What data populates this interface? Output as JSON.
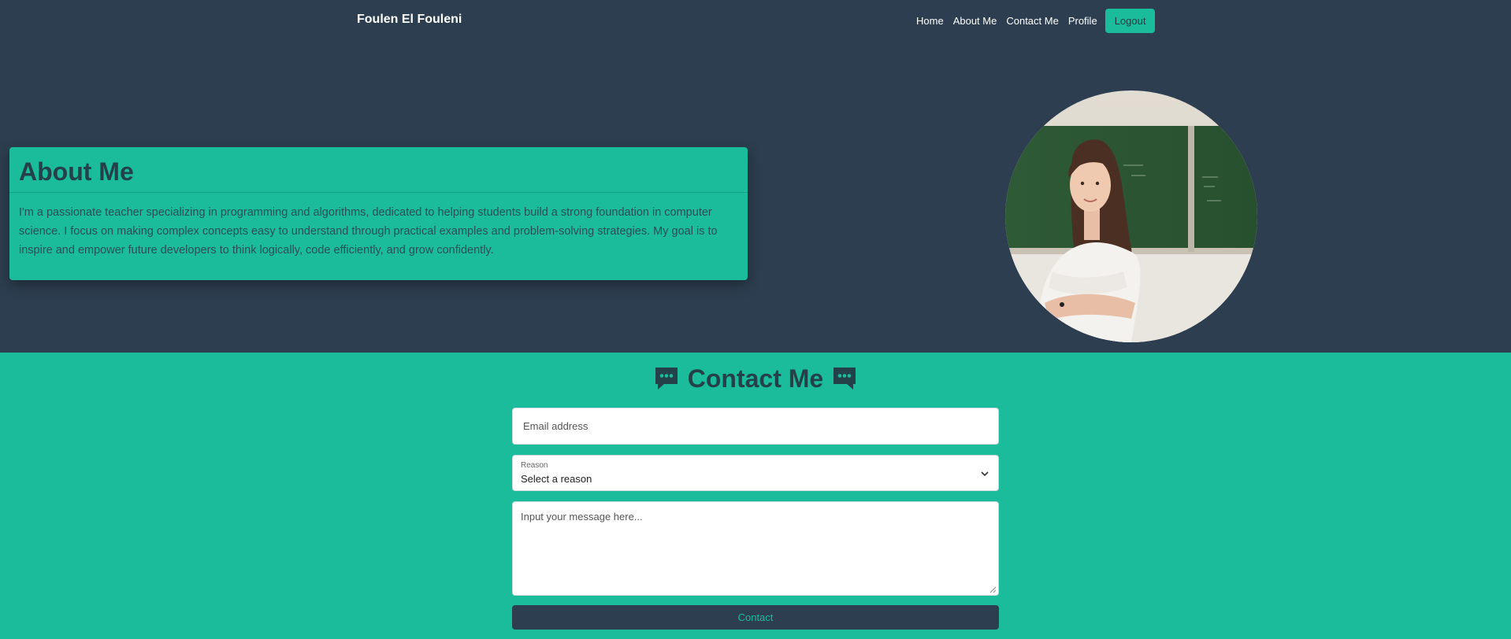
{
  "header": {
    "brand": "Foulen El Fouleni",
    "nav": [
      "Home",
      "About Me",
      "Contact Me",
      "Profile"
    ],
    "logout_label": "Logout"
  },
  "about": {
    "title": "About Me",
    "text": "I'm a passionate teacher specializing in programming and algorithms, dedicated to helping students build a strong foundation in computer science. I focus on making complex concepts easy to understand through practical examples and problem-solving strategies. My goal is to inspire and empower future developers to think logically, code efficiently, and grow confidently."
  },
  "contact": {
    "title": "Contact Me",
    "email_placeholder": "Email address",
    "reason_label": "Reason",
    "reason_value": "Select a reason",
    "message_placeholder": "Input your message here...",
    "submit_label": "Contact"
  },
  "colors": {
    "dark": "#2d3e50",
    "accent": "#1abc9c",
    "heading": "#24414a"
  },
  "icons": [
    "chat-bubble-icon",
    "chevron-down-icon"
  ]
}
